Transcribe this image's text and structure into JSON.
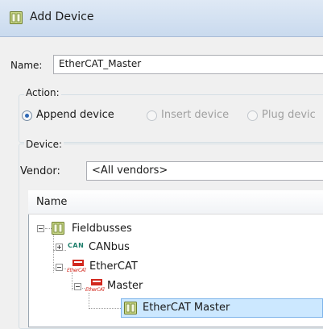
{
  "window": {
    "title": "Add Device",
    "icon": "device-icon"
  },
  "name_field": {
    "label": "Name:",
    "value": "EtherCAT_Master"
  },
  "action_group": {
    "label": "Action:",
    "options": [
      {
        "label": "Append device",
        "selected": true,
        "enabled": true
      },
      {
        "label": "Insert device",
        "selected": false,
        "enabled": false
      },
      {
        "label": "Plug devic",
        "selected": false,
        "enabled": false
      }
    ]
  },
  "device_group": {
    "label": "Device:",
    "vendor_label": "Vendor:",
    "vendor_value": "<All vendors>"
  },
  "tree": {
    "column_header": "Name",
    "items": [
      {
        "label": "Fieldbusses",
        "icon": "device-icon",
        "expander": "minus"
      },
      {
        "label": "CANbus",
        "icon": "can-icon",
        "icon_text": "CAN",
        "expander": "plus"
      },
      {
        "label": "EtherCAT",
        "icon": "ethercat-icon",
        "icon_text": "EtherCAT",
        "expander": "minus"
      },
      {
        "label": "Master",
        "icon": "ethercat-icon",
        "icon_text": "EtherCAT",
        "expander": "minus"
      },
      {
        "label": "EtherCAT Master",
        "icon": "device-icon",
        "expander": "none"
      }
    ]
  }
}
